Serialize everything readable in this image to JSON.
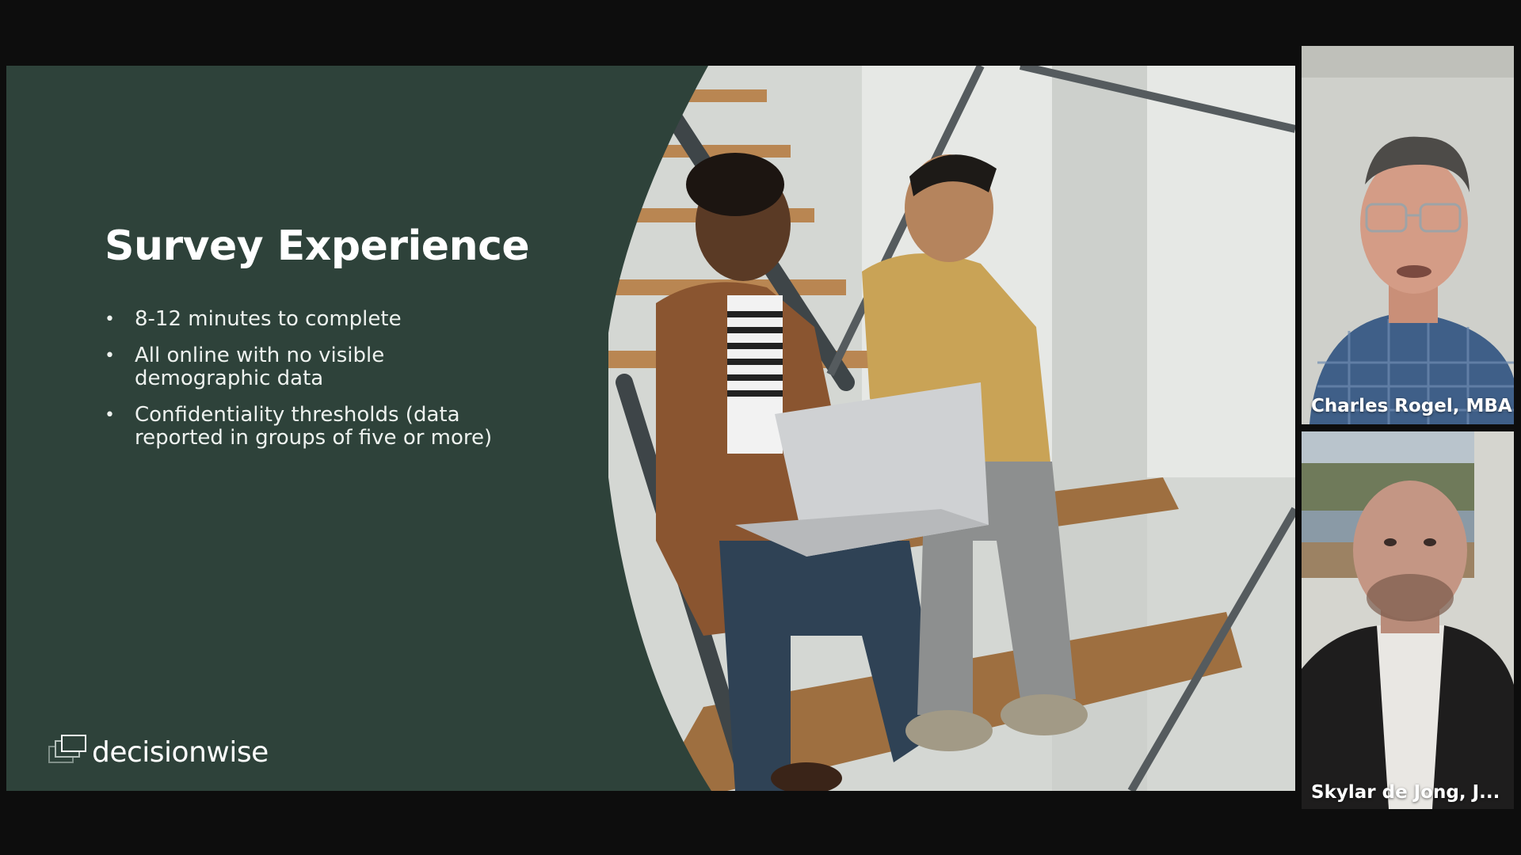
{
  "slide": {
    "title": "Survey Experience",
    "bullets": [
      "8-12 minutes to complete",
      "All online with no visible demographic data",
      "Confidentiality thresholds (data reported in groups of five or more)"
    ],
    "logo_text": "decisionwise",
    "colors": {
      "panel": "#2e423a",
      "text": "#ffffff"
    },
    "photo_description_icon": "photo-people-on-stairs"
  },
  "participants": [
    {
      "name": "Charles Rogel, MBA",
      "icon": "video-feed"
    },
    {
      "name": "Skylar de Jong, J...",
      "icon": "video-feed"
    }
  ],
  "colors": {
    "background": "#0d0d0d"
  }
}
